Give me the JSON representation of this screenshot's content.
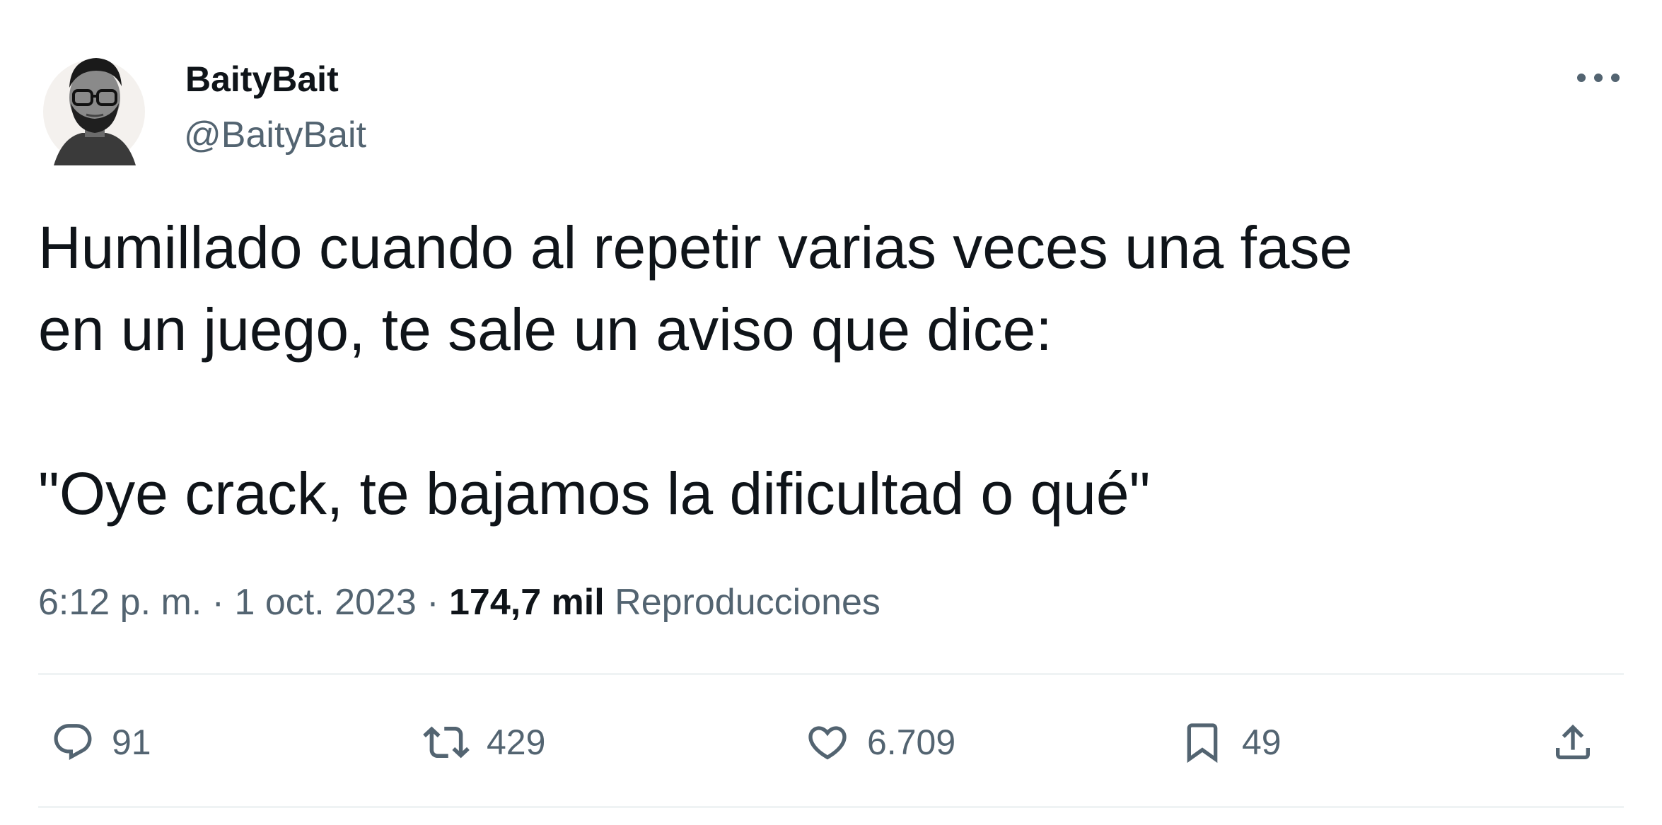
{
  "author": {
    "display_name": "BaityBait",
    "handle": "@BaityBait"
  },
  "menu": {
    "more_icon": "more-horizontal-icon"
  },
  "tweet": {
    "line1": "Humillado cuando al repetir varias veces una fase",
    "line2": "en un juego, te sale un aviso que dice:",
    "quote": "\"Oye crack, te bajamos la dificultad o qué\""
  },
  "meta": {
    "time": "6:12 p. m.",
    "sep1": " · ",
    "date": "1 oct. 2023",
    "sep2": " · ",
    "views_count": "174,7 mil",
    "views_label": " Reproducciones"
  },
  "actions": {
    "reply": {
      "icon": "reply-icon",
      "count": "91"
    },
    "retweet": {
      "icon": "retweet-icon",
      "count": "429"
    },
    "like": {
      "icon": "heart-icon",
      "count": "6.709"
    },
    "bookmark": {
      "icon": "bookmark-icon",
      "count": "49"
    },
    "share": {
      "icon": "share-icon"
    }
  },
  "colors": {
    "text": "#0f1419",
    "secondary": "#536471",
    "divider": "#eff3f4"
  }
}
